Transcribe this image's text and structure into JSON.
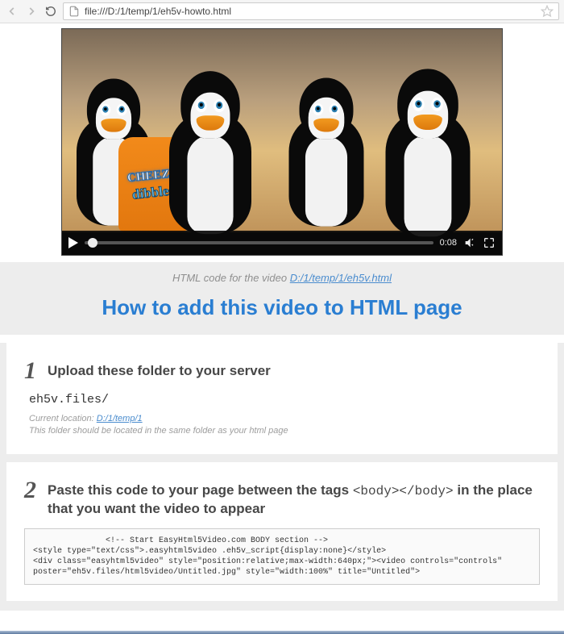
{
  "browser": {
    "url": "file:///D:/1/temp/1/eh5v-howto.html"
  },
  "video": {
    "time": "0:08",
    "bag_line1": "CHEEZY",
    "bag_line2": "dibbles"
  },
  "caption": {
    "prefix": "HTML code for the video ",
    "link_text": "D:/1/temp/1/eh5v.html"
  },
  "page_title": "How to add this video to HTML page",
  "steps": [
    {
      "num": "1",
      "title": "Upload these folder to your server",
      "folder": "eh5v.files/",
      "hint_prefix": "Current location: ",
      "hint_link": "D:/1/temp/1",
      "hint_line2": "This folder should be located in the same folder as your html page"
    },
    {
      "num": "2",
      "title_pre": "Paste this code to your page between the tags ",
      "title_mono": "<body></body>",
      "title_post": " in the place that you want the video to appear",
      "code": "               <!-- Start EasyHtml5Video.com BODY section -->\n<style type=\"text/css\">.easyhtml5video .eh5v_script{display:none}</style>\n<div class=\"easyhtml5video\" style=\"position:relative;max-width:640px;\"><video controls=\"controls\"\nposter=\"eh5v.files/html5video/Untitled.jpg\" style=\"width:100%\" title=\"Untitled\">"
    }
  ]
}
